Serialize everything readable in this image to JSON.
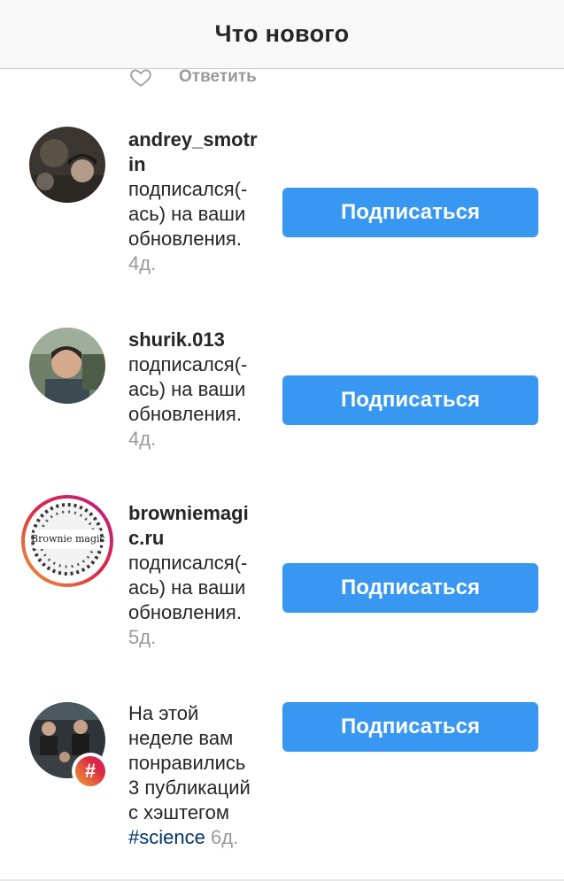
{
  "header": {
    "title": "Что нового"
  },
  "partial": {
    "reply_label": "Ответить"
  },
  "items": [
    {
      "username": "andrey_smotrin",
      "text": "подписался(-ась) на ваши обновления.",
      "time": "4д.",
      "button": "Подписаться"
    },
    {
      "username": "shurik.013",
      "text": "подписался(-ась) на ваши обновления.",
      "time": "4д.",
      "button": "Подписаться"
    },
    {
      "username": "browniemagic.ru",
      "text": "подписался(-ась) на ваши обновления.",
      "time": "5д.",
      "button": "Подписаться",
      "avatar_logo": "Brownie magic"
    },
    {
      "text": "На этой неделе вам понравились 3 публикаций с хэштегом",
      "hashtag": "#science",
      "time": "6д.",
      "button": "Подписаться",
      "badge_icon": "#"
    }
  ],
  "colors": {
    "accent": "#3897f0",
    "muted": "#999999",
    "hashtag": "#003569",
    "text": "#262626"
  }
}
